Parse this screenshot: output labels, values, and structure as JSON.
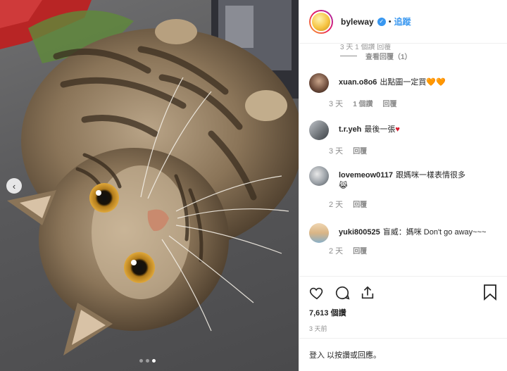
{
  "header": {
    "username": "byleway",
    "separator": "•",
    "follow_label": "追蹤"
  },
  "thread": {
    "previous_meta": "3 天    1 個讚    回覆",
    "view_replies_label": "查看回覆（1）"
  },
  "comments": [
    {
      "user": "xuan.o8o6",
      "text": "出點圖一定買",
      "emoji": "🧡🧡",
      "age": "3 天",
      "likes": "1 個讚",
      "reply": "回覆"
    },
    {
      "user": "t.r.yeh",
      "text": "最後一張",
      "emoji": "♥",
      "age": "3 天",
      "likes": "",
      "reply": "回覆"
    },
    {
      "user": "lovemeow0117",
      "text": "跟媽咪一樣表情很多",
      "emoji": "😹",
      "age": "2 天",
      "likes": "",
      "reply": "回覆"
    },
    {
      "user": "yuki800525",
      "text": "盲威：媽咪 Don't go away~~~",
      "emoji": "",
      "age": "2 天",
      "likes": "",
      "reply": "回覆"
    }
  ],
  "actions": {
    "likes_count": "7,613 個讚",
    "posted_time": "3 天前"
  },
  "login_prompt": "登入 以按讚或回應。",
  "carousel": {
    "slide_count": 3,
    "active_index": 2
  },
  "colors": {
    "link_blue": "#3897f0",
    "text": "#262626",
    "muted": "#8e8e8e"
  }
}
